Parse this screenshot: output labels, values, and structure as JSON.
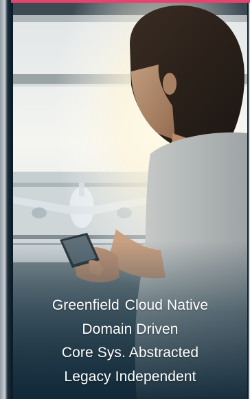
{
  "colors": {
    "accent": "#e8426e",
    "overlay": "#0c2434",
    "caption_text": "#ffffff"
  },
  "image": {
    "subject": "woman-using-smartphone-airport-window-icon"
  },
  "caption": {
    "line1_word1": "Greenfield",
    "line1_word2": "Cloud Native",
    "line2": "Domain Driven",
    "line3": "Core Sys. Abstracted",
    "line4": "Legacy Independent"
  }
}
